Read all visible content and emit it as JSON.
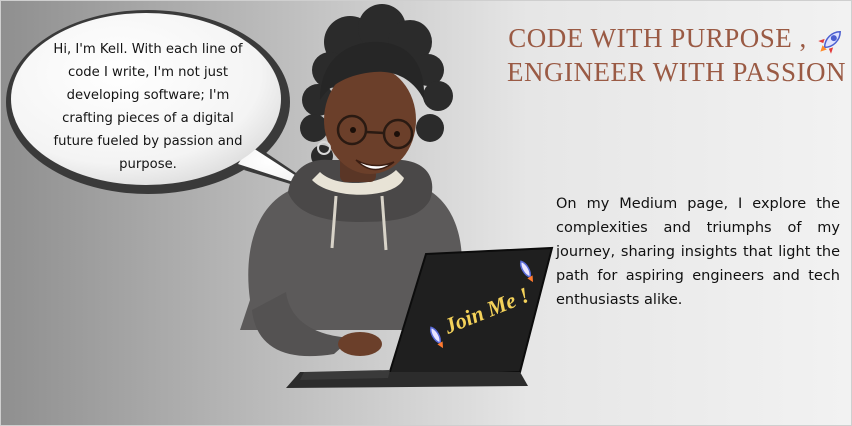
{
  "speech_bubble": {
    "text": "Hi, I'm Kell. With each line of code I write, I'm not just developing software; I'm crafting pieces of a digital future fueled by passion and purpose."
  },
  "headline": {
    "line1": "CODE WITH PURPOSE ,",
    "line2": "ENGINEER WITH  PASSION",
    "color": "#9a5a44"
  },
  "laptop": {
    "sticker_text": "Join Me !",
    "sticker_color": "#f4d25a"
  },
  "description": {
    "text": "On my Medium page, I explore the complexities and triumphs of my journey, sharing insights that light the path for aspiring engineers and tech enthusiasts alike."
  },
  "icons": [
    "rocket-icon",
    "rocket-sticker-icon"
  ]
}
